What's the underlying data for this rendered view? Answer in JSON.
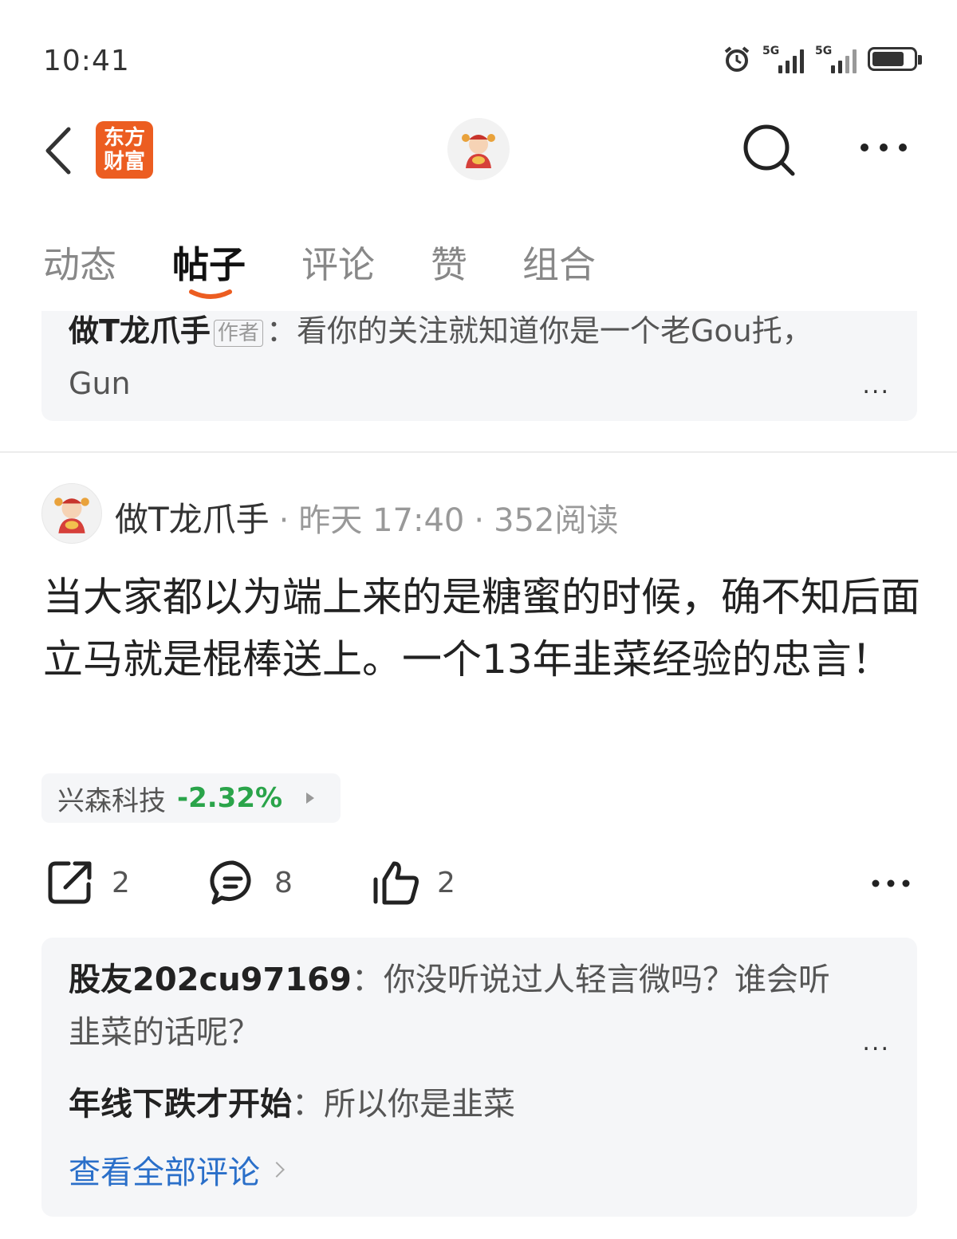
{
  "status_bar": {
    "time": "10:41",
    "network_1": "5G",
    "network_2": "5G",
    "icons": [
      "alarm-icon",
      "signal-icon",
      "signal-icon",
      "battery-icon"
    ]
  },
  "nav": {
    "logo_line1": "东方",
    "logo_line2": "财富",
    "icons": [
      "back-icon",
      "search-icon",
      "more-icon"
    ]
  },
  "tabs": [
    {
      "label": "动态",
      "active": false
    },
    {
      "label": "帖子",
      "active": true
    },
    {
      "label": "评论",
      "active": false
    },
    {
      "label": "赞",
      "active": false
    },
    {
      "label": "组合",
      "active": false
    }
  ],
  "prev_card": {
    "username": "做T龙爪手",
    "author_tag": "作者",
    "text": "：看你的关注就知道你是一个老Gou托，Gun",
    "more": "..."
  },
  "post": {
    "author": "做T龙爪手",
    "time": "昨天 17:40",
    "reads": "352阅读",
    "body": "当大家都以为端上来的是糖蜜的时候，确不知后面立马就是棍棒送上。一个13年韭菜经验的忠言！",
    "stock": {
      "name": "兴森科技",
      "change": "-2.32%",
      "color": "#2aa44a"
    },
    "actions": {
      "share_count": "2",
      "comment_count": "8",
      "like_count": "2"
    }
  },
  "comments": [
    {
      "user": "股友202cu97169",
      "text": "：你没听说过人轻言微吗？谁会听韭菜的话呢？"
    },
    {
      "user": "年线下跌才开始",
      "text": "：所以你是韭菜"
    }
  ],
  "comments_more": "...",
  "view_all": "查看全部评论",
  "colors": {
    "brand": "#ec5d21",
    "link": "#2a6fc9",
    "down": "#2aa44a"
  }
}
